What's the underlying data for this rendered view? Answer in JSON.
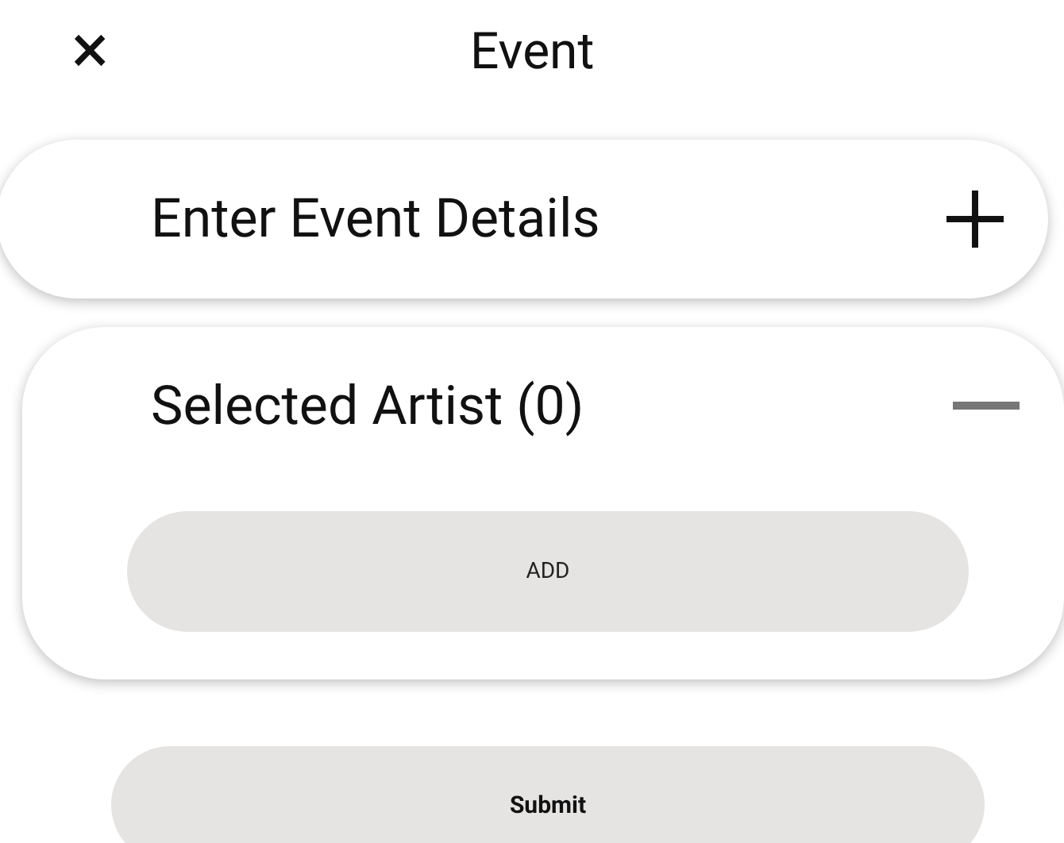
{
  "header": {
    "close": "×",
    "title": "Event"
  },
  "sections": [
    {
      "title": "Enter Event Details",
      "expanded": false
    },
    {
      "title": "Selected Artist (0)",
      "expanded": true,
      "button": "ADD"
    }
  ],
  "submit": "Submit"
}
